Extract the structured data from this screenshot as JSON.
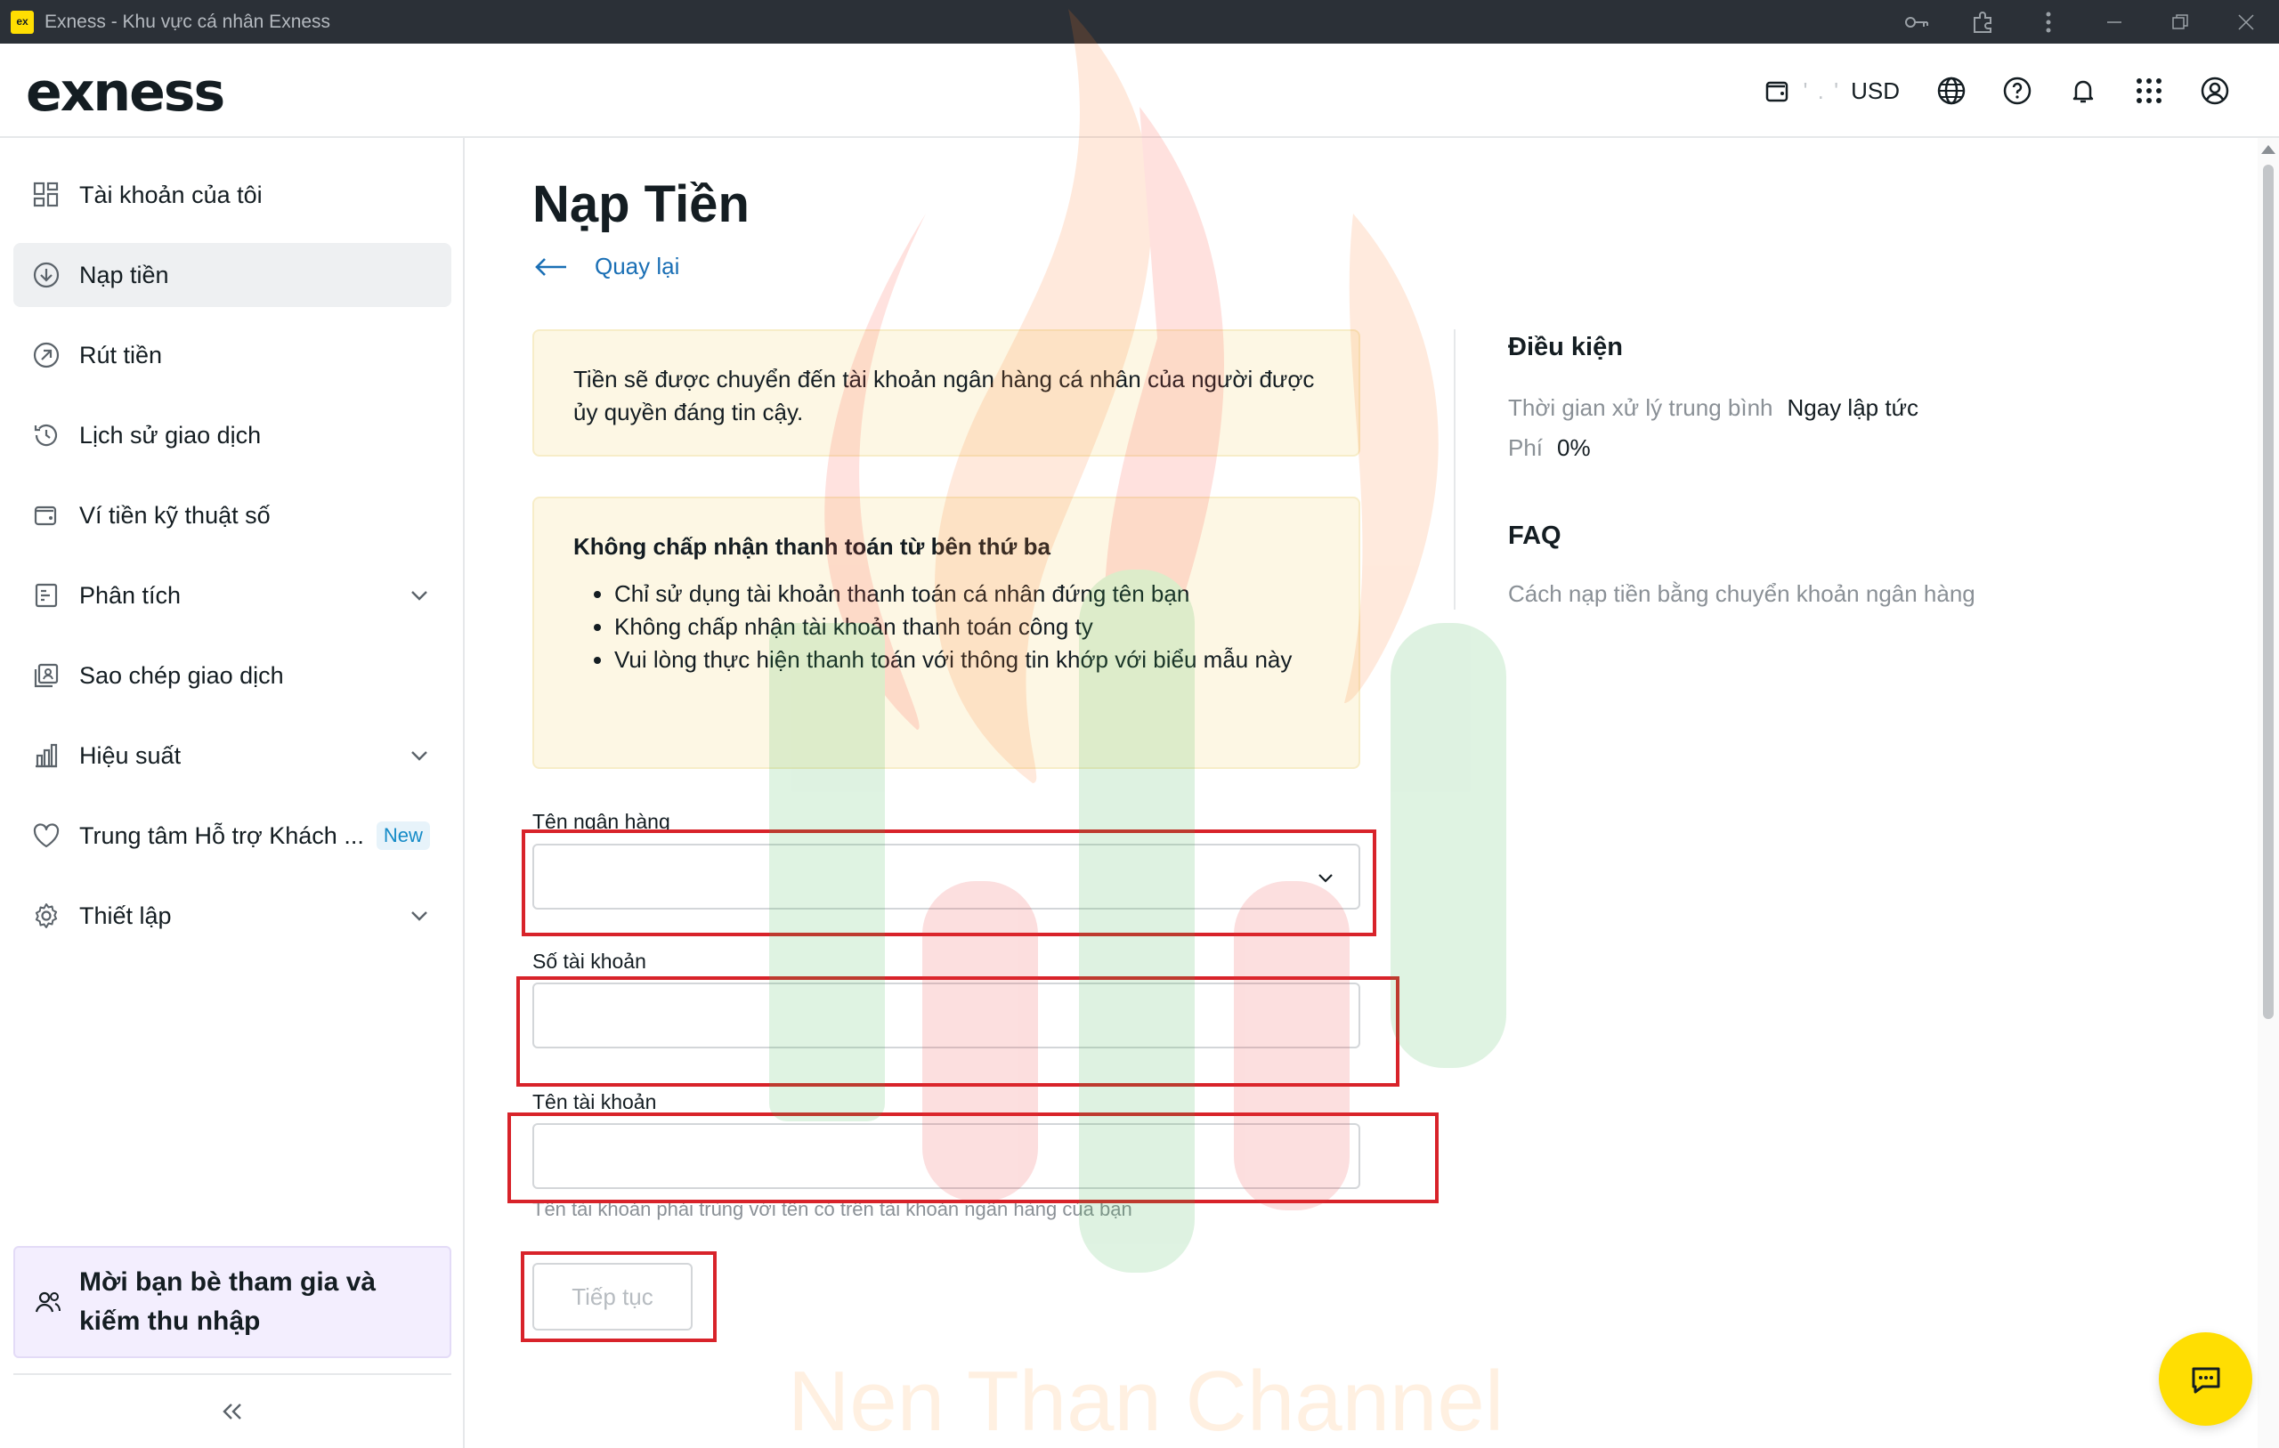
{
  "window": {
    "logo_text": "ex",
    "title": "Exness - Khu vực cá nhân Exness"
  },
  "header": {
    "logo": "exness",
    "balance_masked": "' . '",
    "currency": "USD"
  },
  "sidebar": {
    "items": [
      {
        "label": "Tài khoản của tôi",
        "icon": "dashboard-icon"
      },
      {
        "label": "Nạp tiền",
        "icon": "deposit-icon"
      },
      {
        "label": "Rút tiền",
        "icon": "withdraw-icon"
      },
      {
        "label": "Lịch sử giao dịch",
        "icon": "history-icon"
      },
      {
        "label": "Ví tiền kỹ thuật số",
        "icon": "wallet-icon"
      },
      {
        "label": "Phân tích",
        "icon": "analytics-icon"
      },
      {
        "label": "Sao chép giao dịch",
        "icon": "copy-trading-icon"
      },
      {
        "label": "Hiệu suất",
        "icon": "performance-icon"
      },
      {
        "label": "Trung tâm Hỗ trợ Khách ...",
        "icon": "heart-icon",
        "badge": "New"
      },
      {
        "label": "Thiết lập",
        "icon": "settings-icon"
      }
    ],
    "invite": "Mời bạn bè tham gia và kiếm thu nhập"
  },
  "main": {
    "title": "Nạp Tiền",
    "back": "Quay lại",
    "notice": "Tiền sẽ được chuyển đến tài khoản ngân hàng cá nhân của người được ủy quyền đáng tin cậy.",
    "warning": {
      "title": "Không chấp nhận thanh toán từ bên thứ ba",
      "items": [
        "Chỉ sử dụng tài khoản thanh toán cá nhân đứng tên bạn",
        "Không chấp nhận tài khoản thanh toán công ty",
        "Vui lòng thực hiện thanh toán với thông tin khớp với biểu mẫu này"
      ]
    },
    "form": {
      "bank_name_label": "Tên ngân hàng",
      "bank_name_value": "",
      "account_number_label": "Số tài khoản",
      "account_number_value": "",
      "account_name_label": "Tên tài khoản",
      "account_name_value": "",
      "account_name_hint": "Tên tài khoản phải trùng với tên có trên tài khoản ngân hàng của bạn",
      "submit": "Tiếp tục"
    }
  },
  "conditions": {
    "title": "Điều kiện",
    "processing_label": "Thời gian xử lý trung bình",
    "processing_value": "Ngay lập tức",
    "fee_label": "Phí",
    "fee_value": "0%",
    "faq_title": "FAQ",
    "faq_link": "Cách nạp tiền bằng chuyển khoản ngân hàng"
  },
  "watermark": "Nen Than Channel",
  "colors": {
    "brand_yellow": "#ffde02",
    "link_blue": "#1a6fb5",
    "highlight_red": "#d8232a"
  }
}
